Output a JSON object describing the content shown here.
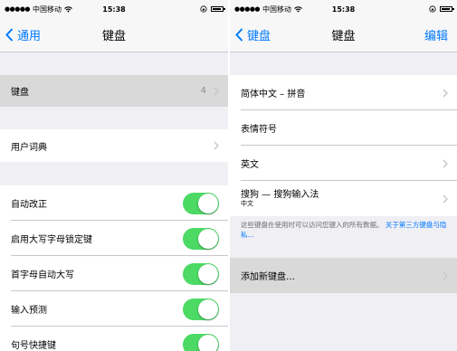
{
  "left": {
    "status": {
      "signal": "●●●●●",
      "carrier": "中国移动",
      "time": "15:38"
    },
    "nav": {
      "back_label": "通用",
      "title": "键盘"
    },
    "keyboards_row": {
      "label": "键盘",
      "count": "4"
    },
    "user_dictionary_label": "用户词典",
    "toggles": [
      {
        "label": "自动改正",
        "on": true
      },
      {
        "label": "启用大写字母锁定键",
        "on": true
      },
      {
        "label": "首字母自动大写",
        "on": true
      },
      {
        "label": "输入预测",
        "on": true
      },
      {
        "label": "句号快捷键",
        "on": true
      }
    ]
  },
  "right": {
    "status": {
      "signal": "●●●●●",
      "carrier": "中国移动",
      "time": "15:38"
    },
    "nav": {
      "back_label": "键盘",
      "title": "键盘",
      "edit_label": "编辑"
    },
    "keyboards": [
      {
        "label": "简体中文 – 拼音",
        "sub": "",
        "chevron": true
      },
      {
        "label": "表情符号",
        "sub": "",
        "chevron": false
      },
      {
        "label": "英文",
        "sub": "",
        "chevron": true
      },
      {
        "label": "搜狗 — 搜狗输入法",
        "sub": "中文",
        "chevron": true
      }
    ],
    "note": {
      "text": "这些键盘在使用时可以访问您键入的所有数据。",
      "link": "关于第三方键盘与隐私…"
    },
    "add_keyboard_label": "添加新键盘…"
  },
  "colors": {
    "accent": "#007aff",
    "toggle_on": "#4cd964",
    "background": "#efeff4",
    "separator": "#c8c7cc"
  }
}
